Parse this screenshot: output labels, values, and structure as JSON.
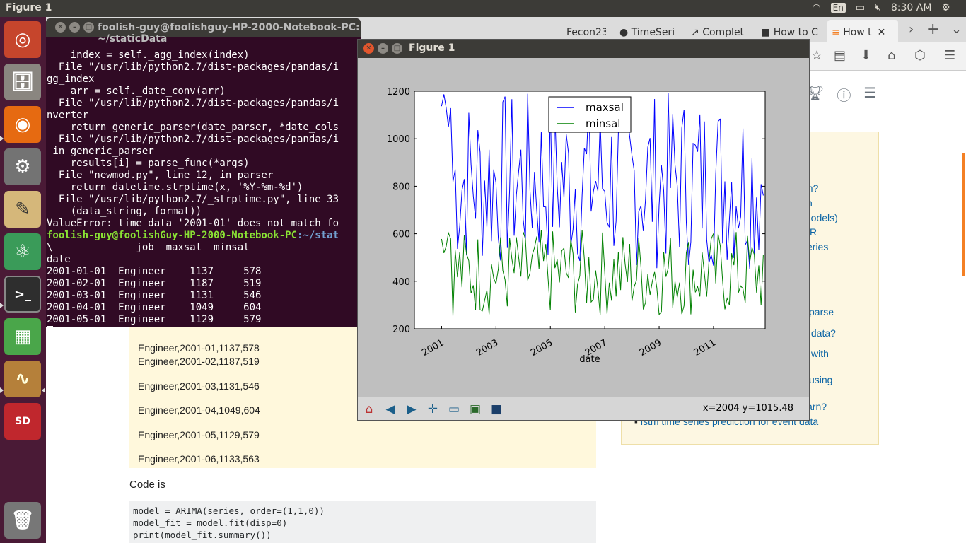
{
  "topbar": {
    "title": "Figure 1",
    "lang": "En",
    "time": "8:30 AM"
  },
  "browser": {
    "tabs": [
      "Fecon23",
      "TimeSeri",
      "Complet",
      "How to C",
      "How t"
    ],
    "question_lines": [
      "Engineer,2001-01,1137,578",
      "Engineer,2001-02,1187,519",
      "Engineer,2001-03,1131,546",
      "Engineer,2001-04,1049,604",
      "Engineer,2001-05,1129,579",
      "Engineer,2001-06,1133,563"
    ],
    "code_label": "Code is",
    "code": "model = ARIMA(series, order=(1,1,0))\nmodel_fit = model.fit(disp=0)\nprint(model_fit.summary())\n# plot residual errors",
    "side_links": [
      "on?",
      "n",
      "models)",
      "R",
      "series",
      "parse",
      "s data?",
      "with",
      "using",
      "arn?",
      "lstm time series prediction for event data"
    ]
  },
  "terminal": {
    "title": "foolish-guy@foolishguy-HP-2000-Notebook-PC: ~/staticData",
    "lines": [
      "    index = self._agg_index(index)",
      "  File \"/usr/lib/python2.7/dist-packages/pandas/i",
      "gg_index",
      "    arr = self._date_conv(arr)",
      "  File \"/usr/lib/python2.7/dist-packages/pandas/i",
      "nverter",
      "    return generic_parser(date_parser, *date_cols",
      "  File \"/usr/lib/python2.7/dist-packages/pandas/i",
      " in generic_parser",
      "    results[i] = parse_func(*args)",
      "  File \"newmod.py\", line 12, in parser",
      "    return datetime.strptime(x, '%Y-%m-%d')",
      "  File \"/usr/lib/python2.7/_strptime.py\", line 33",
      "    (data_string, format))",
      "ValueError: time data '2001-01' does not match fo"
    ],
    "prompt_user": "foolish-guy@foolishGuy-HP-2000-Notebook-PC",
    "prompt_path": ":~/stat",
    "table_lines": [
      "\\              job  maxsal  minsal",
      "date",
      "2001-01-01  Engineer    1137     578",
      "2001-02-01  Engineer    1187     519",
      "2001-03-01  Engineer    1131     546",
      "2001-04-01  Engineer    1049     604",
      "2001-05-01  Engineer    1129     579"
    ]
  },
  "figure": {
    "title": "Figure 1",
    "coords": "x=2004 y=1015.48"
  },
  "chart_data": {
    "type": "line",
    "xlabel": "date",
    "ylabel": "",
    "xlim": [
      2000.0,
      2012.9
    ],
    "ylim": [
      200,
      1200
    ],
    "yticks": [
      200,
      400,
      600,
      800,
      1000,
      1200
    ],
    "xticks": [
      2001,
      2003,
      2005,
      2007,
      2009,
      2011
    ],
    "legend": "top-center",
    "grid": false,
    "series": [
      {
        "name": "maxsal",
        "color": "#0000ff",
        "range": [
          450,
          1200
        ],
        "x_start": 2001.0,
        "monthly": true
      },
      {
        "name": "minsal",
        "color": "#008000",
        "range": [
          250,
          620
        ],
        "x_start": 2001.0,
        "monthly": true
      }
    ],
    "first_points": {
      "x": [
        "2001-01",
        "2001-02",
        "2001-03",
        "2001-04",
        "2001-05"
      ],
      "maxsal": [
        1137,
        1187,
        1131,
        1049,
        1129
      ],
      "minsal": [
        578,
        519,
        546,
        604,
        579
      ]
    }
  }
}
